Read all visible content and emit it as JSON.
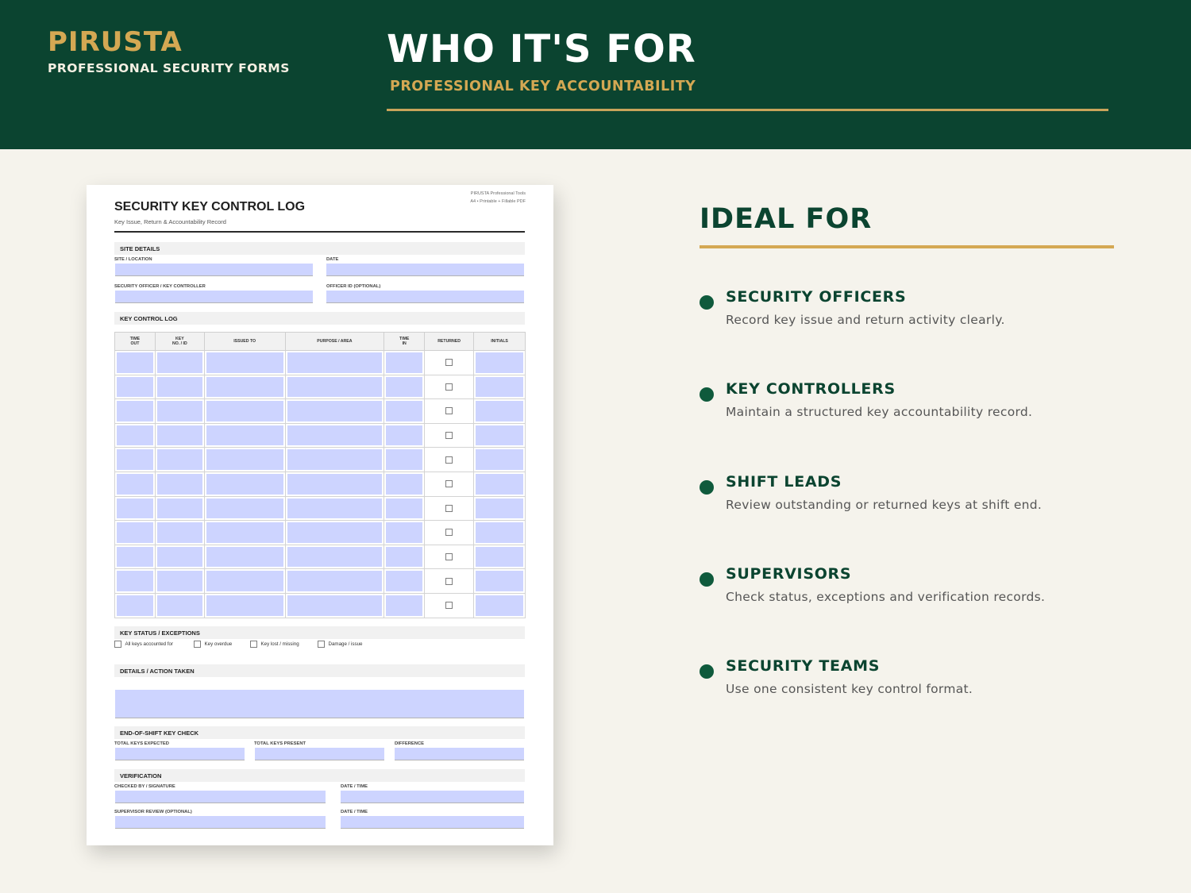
{
  "header": {
    "brand_name": "PIRUSTA",
    "brand_subtitle": "PROFESSIONAL SECURITY FORMS",
    "title": "WHO IT'S FOR",
    "subtitle": "PROFESSIONAL KEY ACCOUNTABILITY"
  },
  "form": {
    "meta_line1": "PIRUSTA Professional Tools",
    "meta_line2": "A4 • Printable + Fillable PDF",
    "title": "SECURITY KEY CONTROL LOG",
    "subtitle": "Key Issue, Return & Accountability Record",
    "site_details": {
      "heading": "SITE DETAILS",
      "site_location": "SITE / LOCATION",
      "date": "DATE",
      "officer": "SECURITY OFFICER / KEY CONTROLLER",
      "officer_id": "OFFICER ID (OPTIONAL)"
    },
    "log": {
      "heading": "KEY CONTROL LOG",
      "columns": [
        {
          "line1": "TIME",
          "line2": "OUT"
        },
        {
          "line1": "KEY",
          "line2": "NO. / ID"
        },
        {
          "line1": "ISSUED TO",
          "line2": ""
        },
        {
          "line1": "PURPOSE / AREA",
          "line2": ""
        },
        {
          "line1": "TIME",
          "line2": "IN"
        },
        {
          "line1": "RETURNED",
          "line2": ""
        },
        {
          "line1": "INITIALS",
          "line2": ""
        }
      ],
      "row_count": 11
    },
    "status": {
      "heading": "KEY STATUS / EXCEPTIONS",
      "options": [
        "All keys accounted for",
        "Key overdue",
        "Key lost / missing",
        "Damage / issue"
      ]
    },
    "details": {
      "heading": "DETAILS / ACTION TAKEN"
    },
    "end_check": {
      "heading": "END-OF-SHIFT KEY CHECK",
      "expected": "TOTAL KEYS EXPECTED",
      "present": "TOTAL KEYS PRESENT",
      "difference": "DIFFERENCE"
    },
    "verification": {
      "heading": "VERIFICATION",
      "checked_by": "CHECKED BY / SIGNATURE",
      "date_time_1": "DATE / TIME",
      "supervisor": "SUPERVISOR REVIEW (OPTIONAL)",
      "date_time_2": "DATE / TIME"
    }
  },
  "ideal": {
    "title": "IDEAL FOR",
    "items": [
      {
        "title": "SECURITY OFFICERS",
        "desc": "Record key issue and return activity clearly."
      },
      {
        "title": "KEY CONTROLLERS",
        "desc": "Maintain a structured key accountability record."
      },
      {
        "title": "SHIFT LEADS",
        "desc": "Review outstanding or returned keys at shift end."
      },
      {
        "title": "SUPERVISORS",
        "desc": "Check status, exceptions and verification records."
      },
      {
        "title": "SECURITY TEAMS",
        "desc": "Use one consistent key control format."
      }
    ]
  },
  "colors": {
    "header_bg": "#0b4430",
    "accent_gold": "#d4a853",
    "page_bg": "#f5f3ec",
    "field_fill": "#cdd4ff",
    "bullet": "#0f5a3c"
  }
}
